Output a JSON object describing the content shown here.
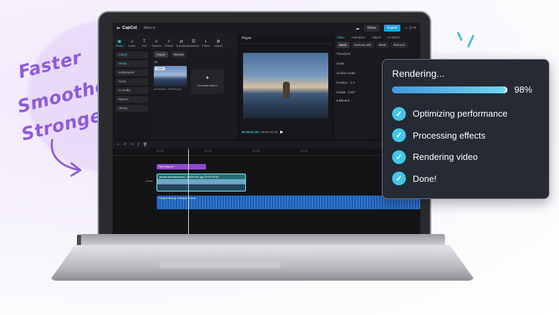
{
  "tagline": [
    "Faster",
    "Smoother",
    "Stronger"
  ],
  "app": {
    "name": "CapCut",
    "menu_label": "Menu",
    "share_label": "Share",
    "export_label": "Export",
    "tools": [
      "Media",
      "Audio",
      "Text",
      "Stickers",
      "Effects",
      "Transitions",
      "Captions",
      "Filters",
      "Adjust"
    ],
    "import_label": "Import",
    "record_label": "Record",
    "media_filter": "All",
    "nav_items": [
      "Import",
      "Media",
      "Subprojects",
      "Yours",
      "AI media",
      "Spaces",
      "Library"
    ],
    "thumb_badge": "Added",
    "thumb_name": "pexels-the...692081.jpg",
    "generate_label": "Generate with AI",
    "player_title": "Player",
    "time_current": "00:00:01:26",
    "time_total": "00:02:04:10",
    "prop_tabs": [
      "Video",
      "Animation",
      "Adjust",
      "AI stylize"
    ],
    "prop_subtabs": [
      "Basic",
      "Remove BG",
      "Mask",
      "Retouch"
    ],
    "prop_rows": [
      "Transform",
      "Scale",
      "Uniform scale",
      "Position",
      "Rotate"
    ],
    "position_x": "0",
    "rotate_value": "0.00°",
    "blend_label": "Blend",
    "ruler": [
      "00:00",
      "00:04",
      "00:08",
      "00:12"
    ],
    "track_text": "Opening Arc",
    "track_clip": "pexels-theblackhood...35620281.jpg  00:00:00:00",
    "track_audio": "Playful Beauty Lifestyle House",
    "cover_label": "Cover"
  },
  "render": {
    "title": "Rendering...",
    "progress": 0.98,
    "percent_label": "98%",
    "steps": [
      "Optimizing performance",
      "Processing effects",
      "Rendering video",
      "Done!"
    ]
  }
}
